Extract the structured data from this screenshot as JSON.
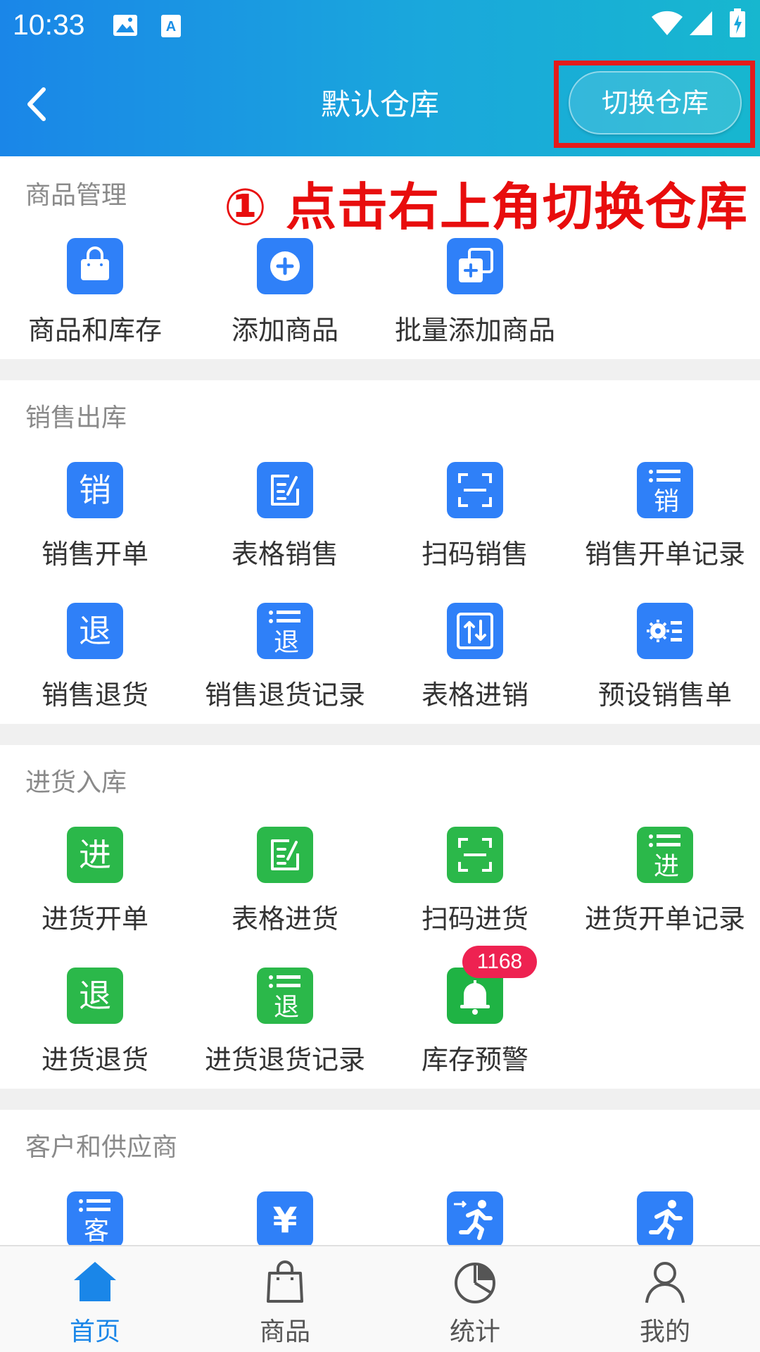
{
  "status_bar": {
    "time": "10:33"
  },
  "header": {
    "title": "默认仓库",
    "switch_label": "切换仓库"
  },
  "annotation": "① 点击右上角切换仓库",
  "sections": {
    "products": {
      "title": "商品管理",
      "items": [
        "商品和库存",
        "添加商品",
        "批量添加商品"
      ]
    },
    "sales": {
      "title": "销售出库",
      "items": [
        "销售开单",
        "表格销售",
        "扫码销售",
        "销售开单记录",
        "销售退货",
        "销售退货记录",
        "表格进销",
        "预设销售单"
      ]
    },
    "purchase": {
      "title": "进货入库",
      "items": [
        "进货开单",
        "表格进货",
        "扫码进货",
        "进货开单记录",
        "进货退货",
        "进货退货记录",
        "库存预警"
      ],
      "badge": "1168"
    },
    "partners": {
      "title": "客户和供应商"
    }
  },
  "icon_glyphs": {
    "sale": "销",
    "return": "退",
    "purchase": "进",
    "customer": "客",
    "yuan": "¥"
  },
  "tabs": [
    "首页",
    "商品",
    "统计",
    "我的"
  ],
  "colors": {
    "blue": "#2f80f8",
    "green": "#2bb84a",
    "active_tab": "#1a86e8",
    "badge": "#ee2251",
    "annotation": "#e80d0d"
  }
}
